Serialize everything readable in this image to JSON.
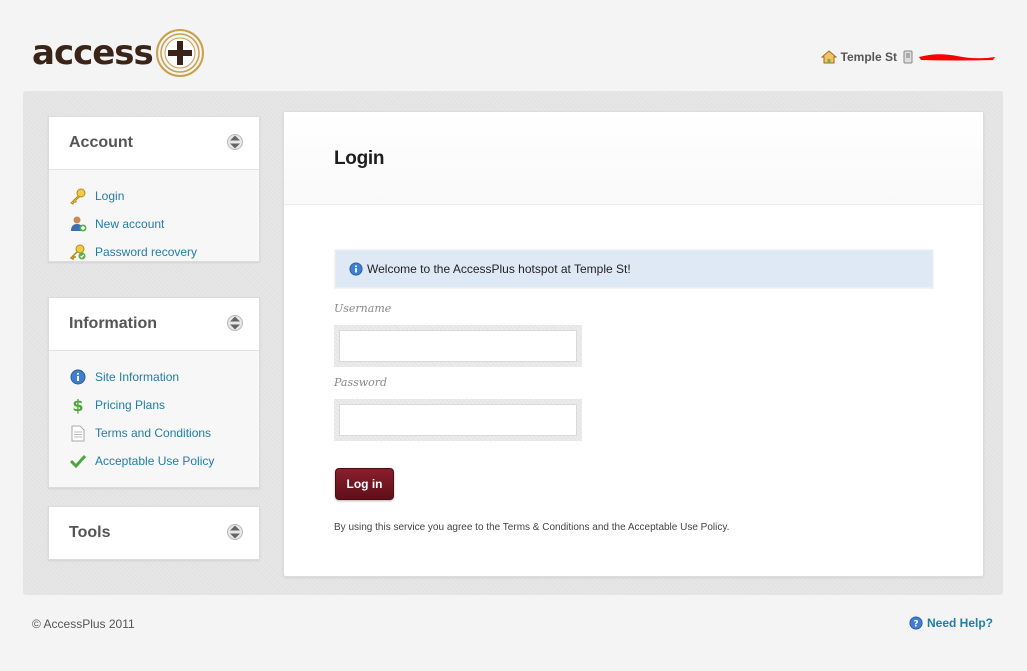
{
  "brand": {
    "logo_text": "access"
  },
  "header": {
    "location": "Temple St"
  },
  "sidebar": {
    "account": {
      "title": "Account",
      "items": [
        {
          "label": "Login",
          "icon": "key-icon"
        },
        {
          "label": "New account",
          "icon": "user-add-icon"
        },
        {
          "label": "Password recovery",
          "icon": "key-recovery-icon"
        }
      ]
    },
    "information": {
      "title": "Information",
      "items": [
        {
          "label": "Site Information",
          "icon": "info-icon"
        },
        {
          "label": "Pricing Plans",
          "icon": "dollar-icon"
        },
        {
          "label": "Terms and Conditions",
          "icon": "document-icon"
        },
        {
          "label": "Acceptable Use Policy",
          "icon": "checkmark-icon"
        }
      ]
    },
    "tools": {
      "title": "Tools"
    }
  },
  "main": {
    "title": "Login",
    "notice": "Welcome to the AccessPlus hotspot at Temple St!",
    "username_label": "Username",
    "username_value": "",
    "password_label": "Password",
    "password_value": "",
    "login_button": "Log in",
    "terms_text": "By using this service you agree to the Terms & Conditions and the Acceptable Use Policy."
  },
  "footer": {
    "copyright": "© AccessPlus 2011",
    "help": "Need Help?"
  },
  "colors": {
    "link": "#1f7ea8",
    "button": "#6e1522",
    "notice_bg": "#dfe9f5",
    "logo_text": "#3a2418",
    "logo_ring": "#c9a14a"
  }
}
